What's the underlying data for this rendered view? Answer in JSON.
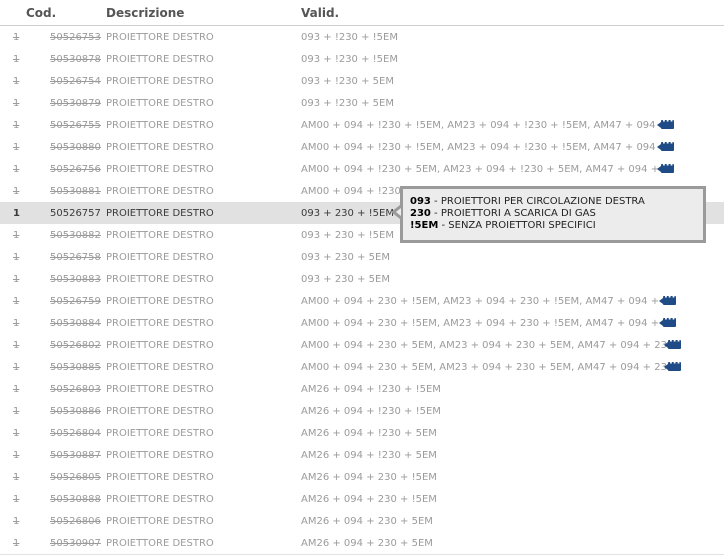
{
  "table": {
    "headers": {
      "code": "Cod.",
      "description": "Descrizione",
      "validity": "Valid."
    },
    "rows": [
      {
        "qty": "1",
        "code": "50526753",
        "description": "PROIETTORE DESTRO",
        "validity": "093 + !230 + !5EM"
      },
      {
        "qty": "1",
        "code": "50530878",
        "description": "PROIETTORE DESTRO",
        "validity": "093 + !230 + !5EM"
      },
      {
        "qty": "1",
        "code": "50526754",
        "description": "PROIETTORE DESTRO",
        "validity": "093 + !230 + 5EM"
      },
      {
        "qty": "1",
        "code": "50530879",
        "description": "PROIETTORE DESTRO",
        "validity": "093 + !230 + 5EM"
      },
      {
        "qty": "1",
        "code": "50526755",
        "description": "PROIETTORE DESTRO",
        "validity": "AM00 + 094 + !230 + !5EM, AM23 + 094 + !230 + !5EM, AM47 + 094 +",
        "has_info": true
      },
      {
        "qty": "1",
        "code": "50530880",
        "description": "PROIETTORE DESTRO",
        "validity": "AM00 + 094 + !230 + !5EM, AM23 + 094 + !230 + !5EM, AM47 + 094 +",
        "has_info": true
      },
      {
        "qty": "1",
        "code": "50526756",
        "description": "PROIETTORE DESTRO",
        "validity": "AM00 + 094 + !230 + 5EM, AM23 + 094 + !230 + 5EM, AM47 + 094 + !",
        "has_info": true
      },
      {
        "qty": "1",
        "code": "50530881",
        "description": "PROIETTORE DESTRO",
        "validity": "AM00 + 094 + !230"
      },
      {
        "qty": "1",
        "code": "50526757",
        "description": "PROIETTORE DESTRO",
        "validity": "093 + 230 + !5EM",
        "active": true
      },
      {
        "qty": "1",
        "code": "50530882",
        "description": "PROIETTORE DESTRO",
        "validity": "093 + 230 + !5EM"
      },
      {
        "qty": "1",
        "code": "50526758",
        "description": "PROIETTORE DESTRO",
        "validity": "093 + 230 + 5EM"
      },
      {
        "qty": "1",
        "code": "50530883",
        "description": "PROIETTORE DESTRO",
        "validity": "093 + 230 + 5EM"
      },
      {
        "qty": "1",
        "code": "50526759",
        "description": "PROIETTORE DESTRO",
        "validity": "AM00 + 094 + 230 + !5EM, AM23 + 094 + 230 + !5EM, AM47 + 094 + 2",
        "has_info": true
      },
      {
        "qty": "1",
        "code": "50530884",
        "description": "PROIETTORE DESTRO",
        "validity": "AM00 + 094 + 230 + !5EM, AM23 + 094 + 230 + !5EM, AM47 + 094 + 2",
        "has_info": true
      },
      {
        "qty": "1",
        "code": "50526802",
        "description": "PROIETTORE DESTRO",
        "validity": "AM00 + 094 + 230 + 5EM, AM23 + 094 + 230 + 5EM, AM47 + 094 + 230",
        "has_info": true
      },
      {
        "qty": "1",
        "code": "50530885",
        "description": "PROIETTORE DESTRO",
        "validity": "AM00 + 094 + 230 + 5EM, AM23 + 094 + 230 + 5EM, AM47 + 094 + 230",
        "has_info": true
      },
      {
        "qty": "1",
        "code": "50526803",
        "description": "PROIETTORE DESTRO",
        "validity": "AM26 + 094 + !230 + !5EM"
      },
      {
        "qty": "1",
        "code": "50530886",
        "description": "PROIETTORE DESTRO",
        "validity": "AM26 + 094 + !230 + !5EM"
      },
      {
        "qty": "1",
        "code": "50526804",
        "description": "PROIETTORE DESTRO",
        "validity": "AM26 + 094 + !230 + 5EM"
      },
      {
        "qty": "1",
        "code": "50530887",
        "description": "PROIETTORE DESTRO",
        "validity": "AM26 + 094 + !230 + 5EM"
      },
      {
        "qty": "1",
        "code": "50526805",
        "description": "PROIETTORE DESTRO",
        "validity": "AM26 + 094 + 230 + !5EM"
      },
      {
        "qty": "1",
        "code": "50530888",
        "description": "PROIETTORE DESTRO",
        "validity": "AM26 + 094 + 230 + !5EM"
      },
      {
        "qty": "1",
        "code": "50526806",
        "description": "PROIETTORE DESTRO",
        "validity": "AM26 + 094 + 230 + 5EM"
      },
      {
        "qty": "1",
        "code": "50530907",
        "description": "PROIETTORE DESTRO",
        "validity": "AM26 + 094 + 230 + 5EM"
      }
    ]
  },
  "tooltip": {
    "lines": [
      {
        "code": "093",
        "text": " - PROIETTORI PER CIRCOLAZIONE DESTRA"
      },
      {
        "code": "230",
        "text": " - PROIETTORI A SCARICA DI GAS"
      },
      {
        "code": "!5EM",
        "text": " - SENZA PROIETTORI SPECIFICI"
      }
    ]
  },
  "icons": {
    "info": "speech-bubble-icon"
  },
  "colors": {
    "active_row": "#e1e1e1",
    "info_icon": "#1f4b86",
    "tooltip_border": "#9a9a9a"
  }
}
